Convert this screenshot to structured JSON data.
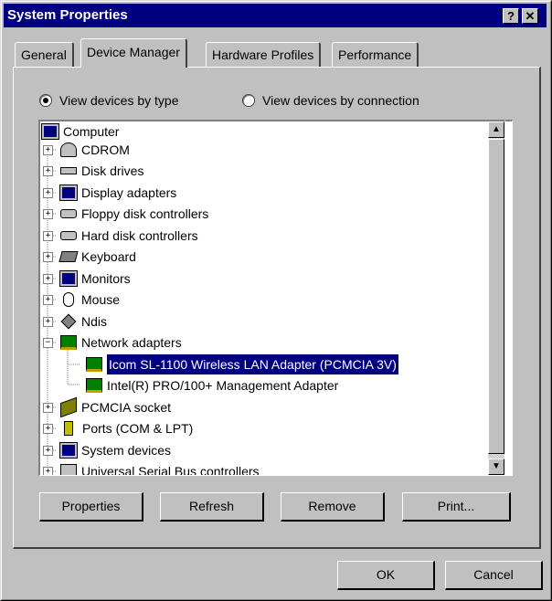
{
  "window": {
    "title": "System Properties",
    "help_btn": "?",
    "close_btn": "✕"
  },
  "tabs": [
    {
      "label": "General"
    },
    {
      "label": "Device Manager",
      "active": true
    },
    {
      "label": "Hardware Profiles"
    },
    {
      "label": "Performance"
    }
  ],
  "view_options": {
    "by_type": "View devices by type",
    "by_connection": "View devices by connection",
    "selected": "by_type"
  },
  "tree": {
    "root": "Computer",
    "items": [
      {
        "label": "CDROM",
        "icon": "cdrom-icon",
        "expander": "+"
      },
      {
        "label": "Disk drives",
        "icon": "disk-icon",
        "expander": "+"
      },
      {
        "label": "Display adapters",
        "icon": "monitor-icon",
        "expander": "+"
      },
      {
        "label": "Floppy disk controllers",
        "icon": "controller-icon",
        "expander": "+"
      },
      {
        "label": "Hard disk controllers",
        "icon": "controller-icon",
        "expander": "+"
      },
      {
        "label": "Keyboard",
        "icon": "keyboard-icon",
        "expander": "+"
      },
      {
        "label": "Monitors",
        "icon": "monitor-icon",
        "expander": "+"
      },
      {
        "label": "Mouse",
        "icon": "mouse-icon",
        "expander": "+"
      },
      {
        "label": "Ndis",
        "icon": "diamond-icon",
        "expander": "+"
      },
      {
        "label": "Network adapters",
        "icon": "network-card-icon",
        "expander": "−"
      },
      {
        "label": "Icom SL-1100 Wireless LAN Adapter (PCMCIA 3V)",
        "icon": "network-card-icon",
        "child": true,
        "selected": true
      },
      {
        "label": "Intel(R) PRO/100+ Management Adapter",
        "icon": "network-card-icon",
        "child": true
      },
      {
        "label": "PCMCIA socket",
        "icon": "pcmcia-icon",
        "expander": "+"
      },
      {
        "label": "Ports (COM & LPT)",
        "icon": "port-icon",
        "expander": "+"
      },
      {
        "label": "System devices",
        "icon": "computer-icon",
        "expander": "+"
      },
      {
        "label": "Universal Serial Bus controllers",
        "icon": "usb-icon",
        "expander": "+"
      }
    ]
  },
  "buttons": {
    "properties": "Properties",
    "refresh": "Refresh",
    "remove": "Remove",
    "print": "Print...",
    "ok": "OK",
    "cancel": "Cancel"
  },
  "colors": {
    "title_bar": "#000080",
    "face": "#c0c0c0",
    "selection": "#000080"
  }
}
